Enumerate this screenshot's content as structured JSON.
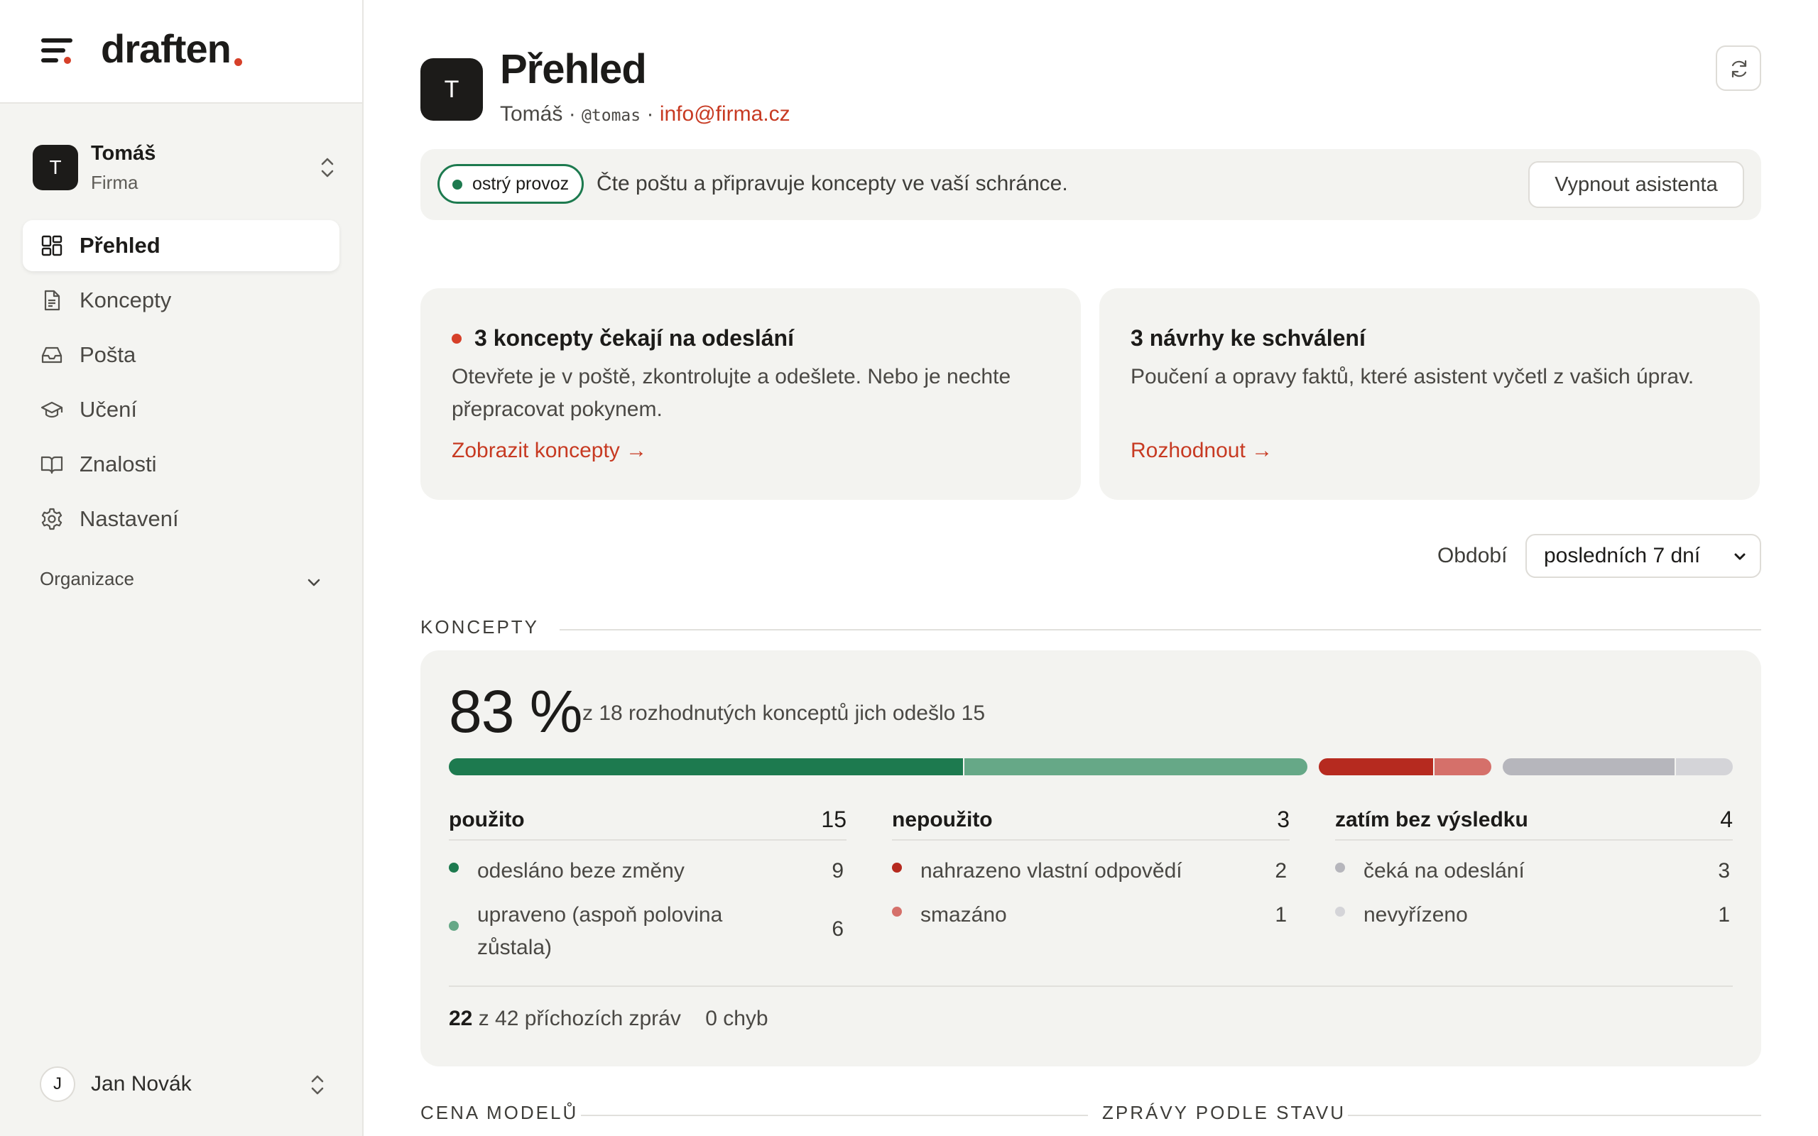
{
  "brand": {
    "name": "draften",
    "accent": "#d64029"
  },
  "sidebar": {
    "org": {
      "avatar": "T",
      "name": "Tomáš",
      "sub": "Firma"
    },
    "items": [
      {
        "label": "Přehled",
        "icon": "dashboard-grid-icon",
        "active": true
      },
      {
        "label": "Koncepty",
        "icon": "document-icon"
      },
      {
        "label": "Pošta",
        "icon": "inbox-icon"
      },
      {
        "label": "Učení",
        "icon": "graduation-cap-icon"
      },
      {
        "label": "Znalosti",
        "icon": "book-icon"
      },
      {
        "label": "Nastavení",
        "icon": "gear-icon"
      }
    ],
    "group_label": "Organizace",
    "user": {
      "avatar": "J",
      "name": "Jan Novák"
    }
  },
  "header": {
    "avatar": "T",
    "title": "Přehled",
    "name": "Tomáš",
    "handle": "@tomas",
    "email": "info@firma.cz",
    "sep": "·"
  },
  "status": {
    "pill": "ostrý provoz",
    "text": "Čte poštu a připravuje koncepty ve vaší schránce.",
    "button": "Vypnout asistenta",
    "color": "#1d7a4f"
  },
  "cards": [
    {
      "title": "3 koncepty čekají na odeslání",
      "body": "Otevřete je v poště, zkontrolujte a odešlete. Nebo je nechte přepracovat pokynem.",
      "link": "Zobrazit koncepty →"
    },
    {
      "title": "3 návrhy ke schválení",
      "body": "Poučení a opravy faktů, které asistent vyčetl z vašich úprav.",
      "link": "Rozhodnout →"
    }
  ],
  "period": {
    "label": "Období",
    "value": "posledních 7 dní"
  },
  "sections": {
    "drafts": "KONCEPTY",
    "model_cost": "CENA MODELŮ",
    "messages_by_status": "ZPRÁVY PODLE STAVU"
  },
  "summary": {
    "percent": "83 %",
    "description": "z 18 rozhodnutých konceptů jich odešlo 15",
    "groups": [
      {
        "name": "použito",
        "total": "15",
        "rows": [
          {
            "label": "odesláno beze změny",
            "value": "9",
            "color": "#1d7a4f"
          },
          {
            "label": "upraveno (aspoň polovina zůstala)",
            "value": "6",
            "color": "#66a887"
          }
        ]
      },
      {
        "name": "nepoužito",
        "total": "3",
        "rows": [
          {
            "label": "nahrazeno vlastní odpovědí",
            "value": "2",
            "color": "#b62a1f"
          },
          {
            "label": "smazáno",
            "value": "1",
            "color": "#d5706a"
          }
        ]
      },
      {
        "name": "zatím bez výsledku",
        "total": "4",
        "rows": [
          {
            "label": "čeká na odeslání",
            "value": "3",
            "color": "#b6b6bc"
          },
          {
            "label": "nevyřízeno",
            "value": "1",
            "color": "#d4d4d8"
          }
        ]
      }
    ],
    "bar": [
      9,
      6,
      2,
      1,
      3,
      1
    ],
    "footer": {
      "count": "22",
      "count_text": "z 42 příchozích zpráv",
      "errors": "0 chyb"
    }
  }
}
